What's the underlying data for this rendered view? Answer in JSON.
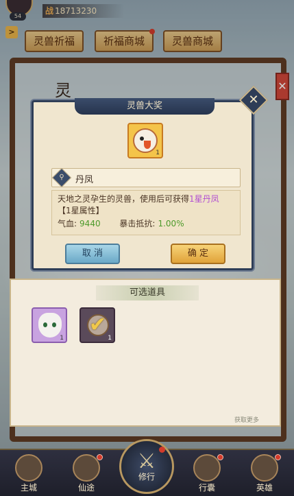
{
  "header": {
    "level": "54",
    "power_label": "战",
    "power_value": "18713230"
  },
  "tabs": [
    {
      "label": "灵兽祈福"
    },
    {
      "label": "祈福商城"
    },
    {
      "label": "灵兽商城"
    }
  ],
  "background": {
    "ling_char": "灵"
  },
  "modal": {
    "title": "灵兽大奖",
    "item_count": "1",
    "item_name": "丹凤",
    "description_prefix": "天地之灵孕生的灵兽，使用后可获得",
    "description_highlight": "1星丹凤",
    "description_suffix": "【1星属性】",
    "stats": [
      {
        "label": "气血:",
        "value": "9440"
      },
      {
        "label": "暴击抵抗:",
        "value": "1.00%"
      }
    ],
    "cancel_label": "取 消",
    "confirm_label": "确 定"
  },
  "panel": {
    "title": "可选道具",
    "slots": [
      {
        "count": "1",
        "selected": false
      },
      {
        "count": "1",
        "selected": true
      }
    ],
    "get_more": "获取更多"
  },
  "nav": {
    "items": [
      {
        "label": "主城"
      },
      {
        "label": "仙途"
      },
      {
        "label": "修行"
      },
      {
        "label": "行囊"
      },
      {
        "label": "英雄"
      }
    ]
  },
  "colors": {
    "modal_border": "#2e3d57",
    "highlight_purple": "#b14fd2",
    "stat_green": "#4c9a2a",
    "confirm_gold": "#e0a33a",
    "cancel_blue": "#6aa9c7"
  }
}
